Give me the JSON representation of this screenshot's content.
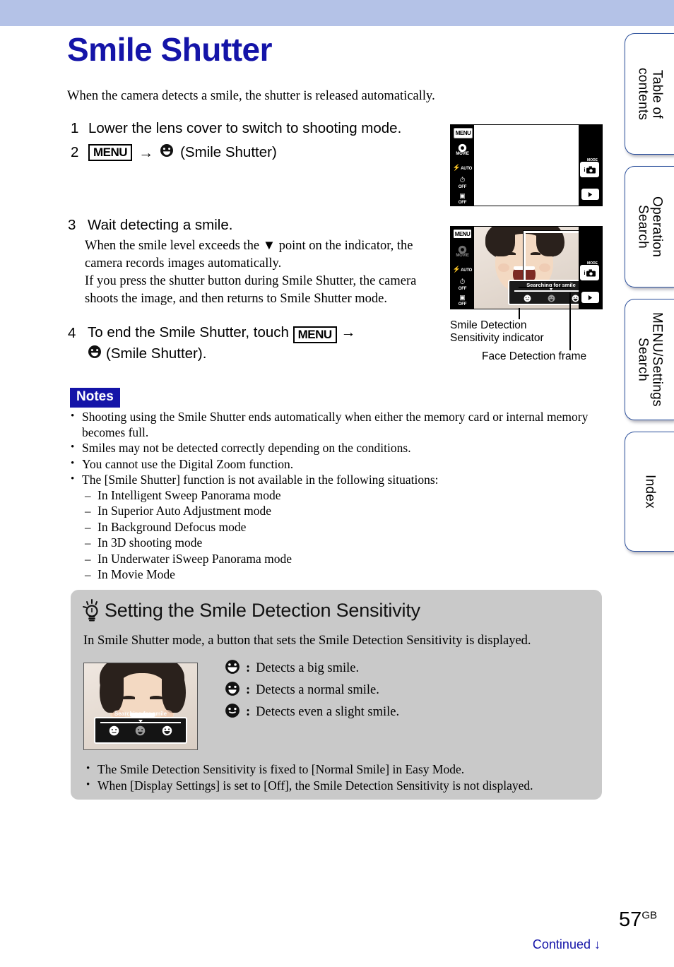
{
  "page": {
    "title": "Smile Shutter",
    "lead": "When the camera detects a smile, the shutter is released automatically.",
    "number": "57",
    "number_suffix": "GB",
    "continued": "Continued",
    "continued_arrow": "↓",
    "header_color": "#b4c2e7",
    "title_color": "#1414a8",
    "notes_label_color": "#1414a8",
    "tipbox_color": "#c9c9c9"
  },
  "side_tabs": [
    {
      "label": "Table of\ncontents",
      "name": "table-of-contents"
    },
    {
      "label": "Operation\nSearch",
      "name": "operation-search"
    },
    {
      "label": "MENU/Settings\nSearch",
      "name": "menu-settings-search"
    },
    {
      "label": "Index",
      "name": "index"
    }
  ],
  "steps": {
    "s1_num": "1",
    "s1_text": "Lower the lens cover to switch to shooting mode.",
    "s2_num": "2",
    "s2_menu": "MENU",
    "s2_arrow": "→",
    "s2_text": "(Smile Shutter)",
    "s3_num": "3",
    "s3_text": "Wait detecting a smile.",
    "s3_body_1": "When the smile level exceeds the ▼ point on the indicator, the camera records images automatically.",
    "s3_body_2": "If you press the shutter button during Smile Shutter, the camera shoots the image, and then returns to Smile Shutter mode.",
    "s4_num": "4",
    "s4_text": "To end the Smile Shutter, touch",
    "s4_menu": "MENU",
    "s4_arrow": "→",
    "s4_text2": "(Smile Shutter)."
  },
  "notes": {
    "label": "Notes",
    "items": [
      "Shooting using the Smile Shutter ends automatically when either the memory card or internal memory becomes full.",
      "Smiles may not be detected correctly depending on the conditions.",
      "You cannot use the Digital Zoom function.",
      "The [Smile Shutter] function is not available in the following situations:"
    ],
    "sub_items": [
      "In Intelligent Sweep Panorama mode",
      "In Superior Auto Adjustment mode",
      "In Background Defocus mode",
      "In 3D shooting mode",
      "In Underwater iSweep Panorama mode",
      "In Movie Mode"
    ]
  },
  "tip": {
    "title": "Setting the Smile Detection Sensitivity",
    "intro": "In Smile Shutter mode, a button that sets the Smile Detection Sensitivity is displayed.",
    "sensitivity": [
      {
        "separator": ":",
        "text": "Detects a big smile.",
        "icon": "big-smile-icon"
      },
      {
        "separator": ":",
        "text": "Detects a normal smile.",
        "icon": "normal-smile-icon"
      },
      {
        "separator": ":",
        "text": "Detects even a slight smile.",
        "icon": "slight-smile-icon"
      }
    ],
    "notes": [
      "The Smile Detection Sensitivity is fixed to [Normal Smile] in Easy Mode.",
      "When [Display Settings] is set to [Off], the Smile Detection Sensitivity is not displayed."
    ],
    "photo_overlay": "Searching for smile"
  },
  "lcd": {
    "menu_label": "MENU",
    "movie_label": "MOVIE",
    "flash_label": "AUTO",
    "timer_label": "OFF",
    "burst_label": "OFF",
    "mode_label": "MODE",
    "searching_caption": "Searching for smile"
  },
  "callouts": {
    "sensitivity_indicator": "Smile Detection\nSensitivity indicator",
    "face_frame": "Face Detection frame"
  }
}
